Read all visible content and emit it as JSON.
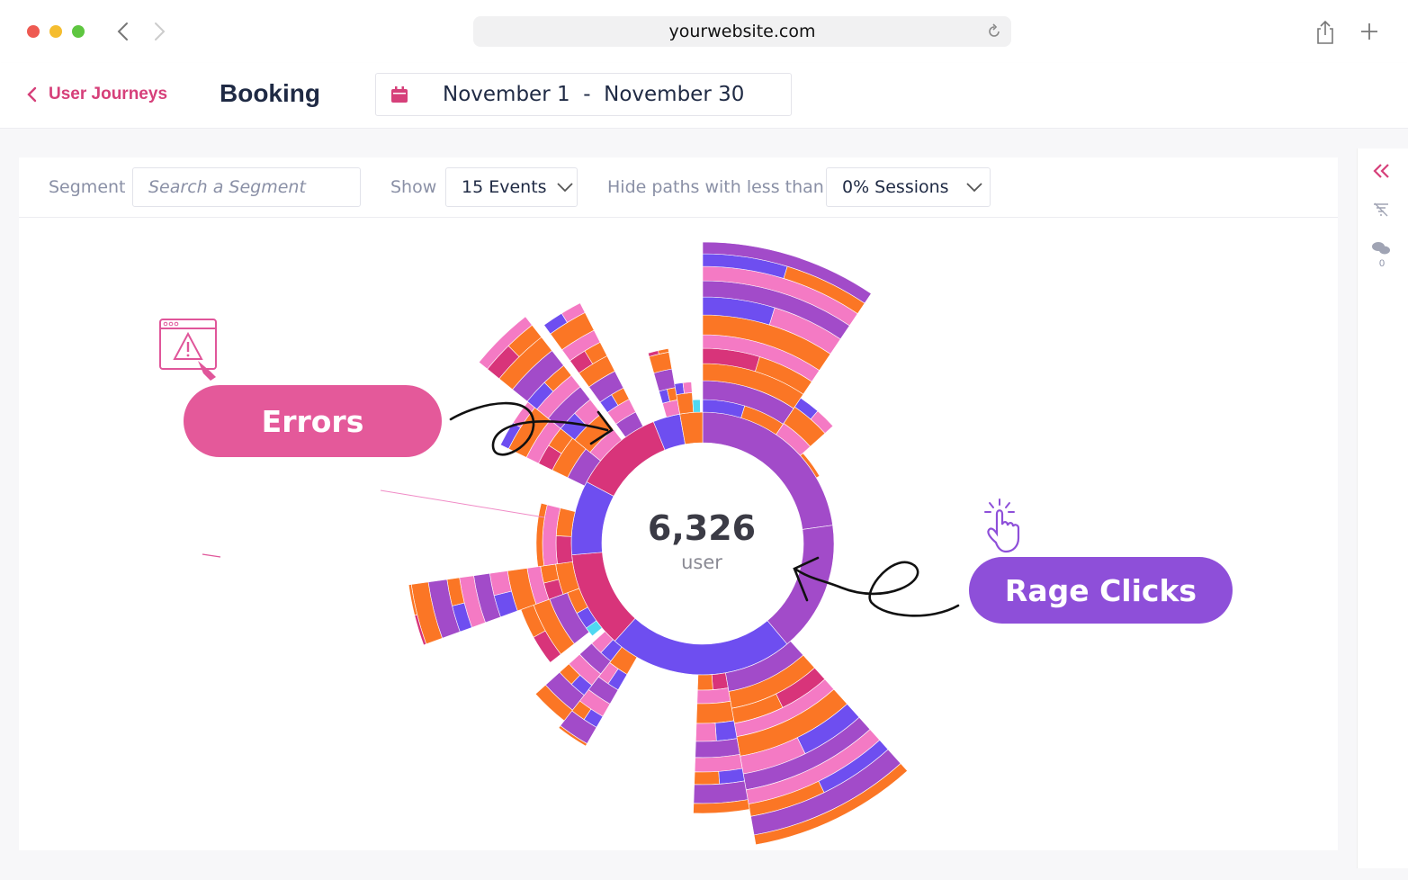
{
  "browser": {
    "url": "yourwebsite.com",
    "dots": [
      "#ee5a52",
      "#f5bd2f",
      "#5ec640"
    ]
  },
  "header": {
    "back_label": "User Journeys",
    "title": "Booking",
    "date_range": "November 1  -  November 30"
  },
  "toolbar": {
    "segment_label": "Segment",
    "segment_placeholder": "Search a Segment",
    "show_label": "Show",
    "show_value": "15 Events",
    "hide_label": "Hide paths with less than",
    "hide_value": "0% Sessions"
  },
  "sidebar": {
    "comments_count": "0"
  },
  "sunburst": {
    "center_value": "6,326",
    "center_label": "user"
  },
  "callouts": {
    "errors": "Errors",
    "rage_clicks": "Rage Clicks"
  },
  "colors": {
    "accent_pink": "#d6407a",
    "errors_pill": "#e4599a",
    "rage_pill": "#8e4fd9",
    "violet": "#6e4ef0",
    "purple": "#a24bc9",
    "orange": "#fb7625",
    "magenta": "#d8347a",
    "pink": "#f47ac4",
    "cyan": "#4fd8f1"
  }
}
